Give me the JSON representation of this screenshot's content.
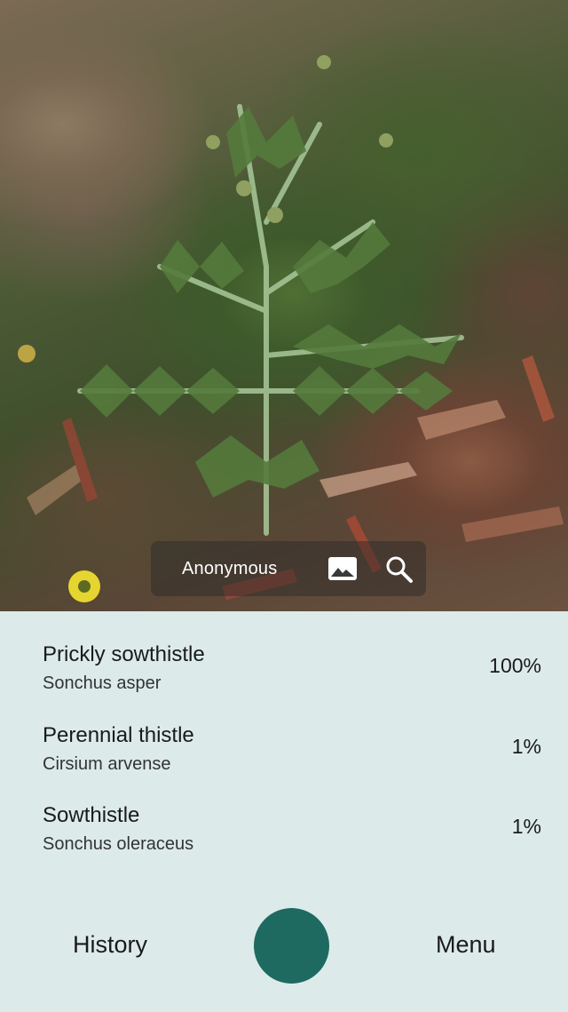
{
  "overlay": {
    "user_label": "Anonymous",
    "gallery_icon": "image-icon",
    "search_icon": "search-icon"
  },
  "results": [
    {
      "common_name": "Prickly sowthistle",
      "scientific_name": "Sonchus asper",
      "confidence": "100%"
    },
    {
      "common_name": "Perennial thistle",
      "scientific_name": "Cirsium arvense",
      "confidence": "1%"
    },
    {
      "common_name": "Sowthistle",
      "scientific_name": "Sonchus oleraceus",
      "confidence": "1%"
    }
  ],
  "nav": {
    "history_label": "History",
    "menu_label": "Menu"
  },
  "colors": {
    "panel_background": "#dceaea",
    "shutter_button": "#1e6a60"
  }
}
